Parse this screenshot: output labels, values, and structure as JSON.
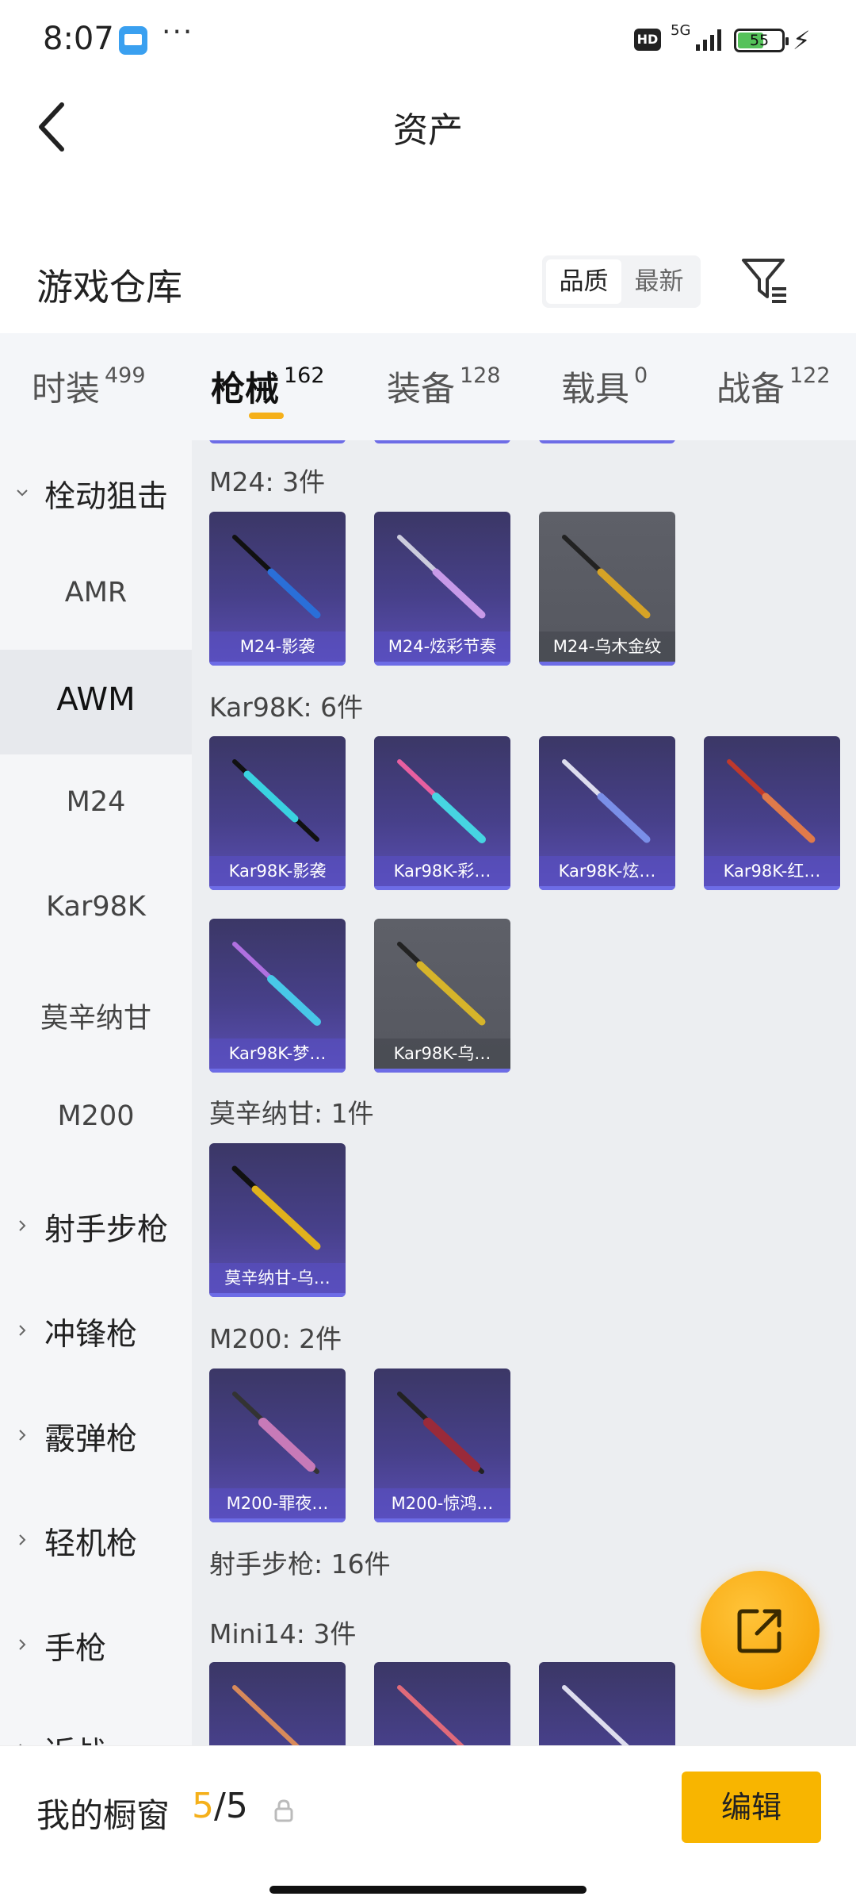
{
  "status_bar": {
    "time": "8:07",
    "more": "···",
    "hd": "HD",
    "network": "5G",
    "battery": "55"
  },
  "header": {
    "title": "资产",
    "back_icon": "chevron-left-icon"
  },
  "warehouse": {
    "title": "游戏仓库",
    "sort_options": [
      "品质",
      "最新"
    ],
    "sort_selected": "品质",
    "filter_icon": "filter-icon"
  },
  "tabs": [
    {
      "label": "时装",
      "count": "499"
    },
    {
      "label": "枪械",
      "count": "162"
    },
    {
      "label": "装备",
      "count": "128"
    },
    {
      "label": "载具",
      "count": "0"
    },
    {
      "label": "战备",
      "count": "122"
    }
  ],
  "active_tab": "枪械",
  "sidebar": [
    {
      "label": "栓动狙击",
      "type": "group",
      "expanded": true
    },
    {
      "label": "AMR",
      "type": "item"
    },
    {
      "label": "AWM",
      "type": "item",
      "active": true
    },
    {
      "label": "M24",
      "type": "item"
    },
    {
      "label": "Kar98K",
      "type": "item"
    },
    {
      "label": "莫辛纳甘",
      "type": "item"
    },
    {
      "label": "M200",
      "type": "item"
    },
    {
      "label": "射手步枪",
      "type": "group"
    },
    {
      "label": "冲锋枪",
      "type": "group"
    },
    {
      "label": "霰弹枪",
      "type": "group"
    },
    {
      "label": "轻机枪",
      "type": "group"
    },
    {
      "label": "手枪",
      "type": "group"
    },
    {
      "label": "近战",
      "type": "group"
    }
  ],
  "groups": [
    {
      "title": "M24: 3件",
      "items": [
        "M24-影袭",
        "M24-炫彩节奏",
        "M24-乌木金纹"
      ]
    },
    {
      "title": "Kar98K: 6件",
      "items": [
        "Kar98K-影袭",
        "Kar98K-彩…",
        "Kar98K-炫…",
        "Kar98K-红…",
        "Kar98K-梦…",
        "Kar98K-乌…"
      ]
    },
    {
      "title": "莫辛纳甘: 1件",
      "items": [
        "莫辛纳甘-乌…"
      ]
    },
    {
      "title": "M200: 2件",
      "items": [
        "M200-罪夜…",
        "M200-惊鸿…"
      ]
    },
    {
      "title": "射手步枪: 16件",
      "items": []
    },
    {
      "title": "Mini14: 3件",
      "items": []
    }
  ],
  "fab_icon": "share-external-icon",
  "bottom_bar": {
    "label": "我的橱窗",
    "count_current": "5",
    "count_total": "/5",
    "lock_icon": "lock-icon",
    "edit_label": "编辑"
  },
  "colors": {
    "accent": "#f5b01a",
    "card_purple": "#4a428e",
    "card_grey": "#5a5c63"
  }
}
